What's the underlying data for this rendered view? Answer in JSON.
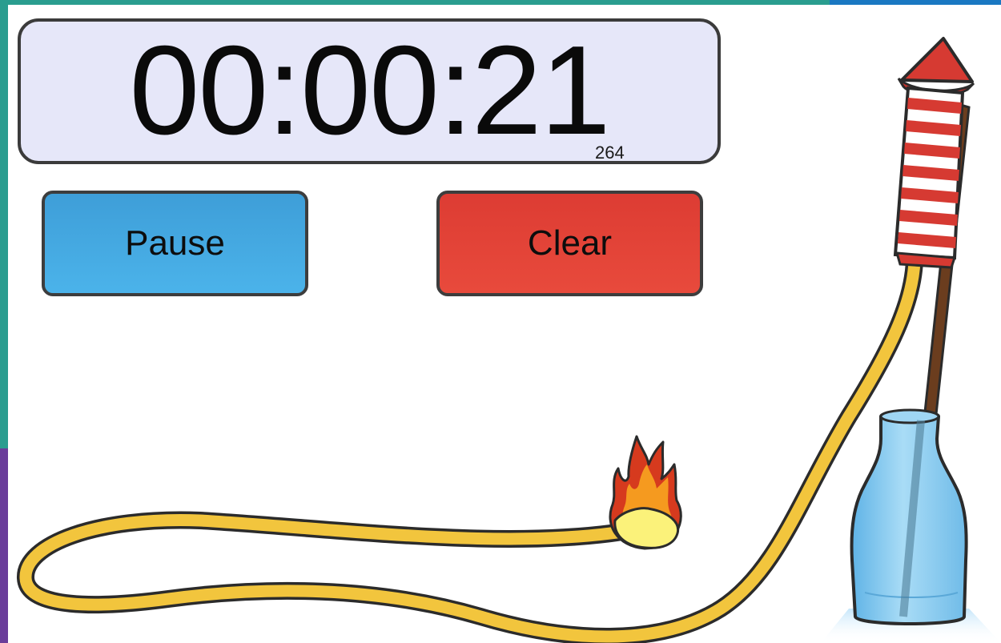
{
  "timer": {
    "display": "00:00:21",
    "milliseconds": "264"
  },
  "buttons": {
    "pause_label": "Pause",
    "clear_label": "Clear"
  },
  "colors": {
    "timer_background": "#e6e7f9",
    "pause_button": "#45a9e2",
    "clear_button": "#e3433a",
    "fuse": "#f2c53d",
    "rocket_stripe_red": "#d63a32",
    "bottle": "#8fcdf0"
  },
  "illustration": {
    "icons": [
      "rocket-icon",
      "fuse-icon",
      "flame-icon",
      "bottle-icon",
      "stick-icon"
    ]
  }
}
